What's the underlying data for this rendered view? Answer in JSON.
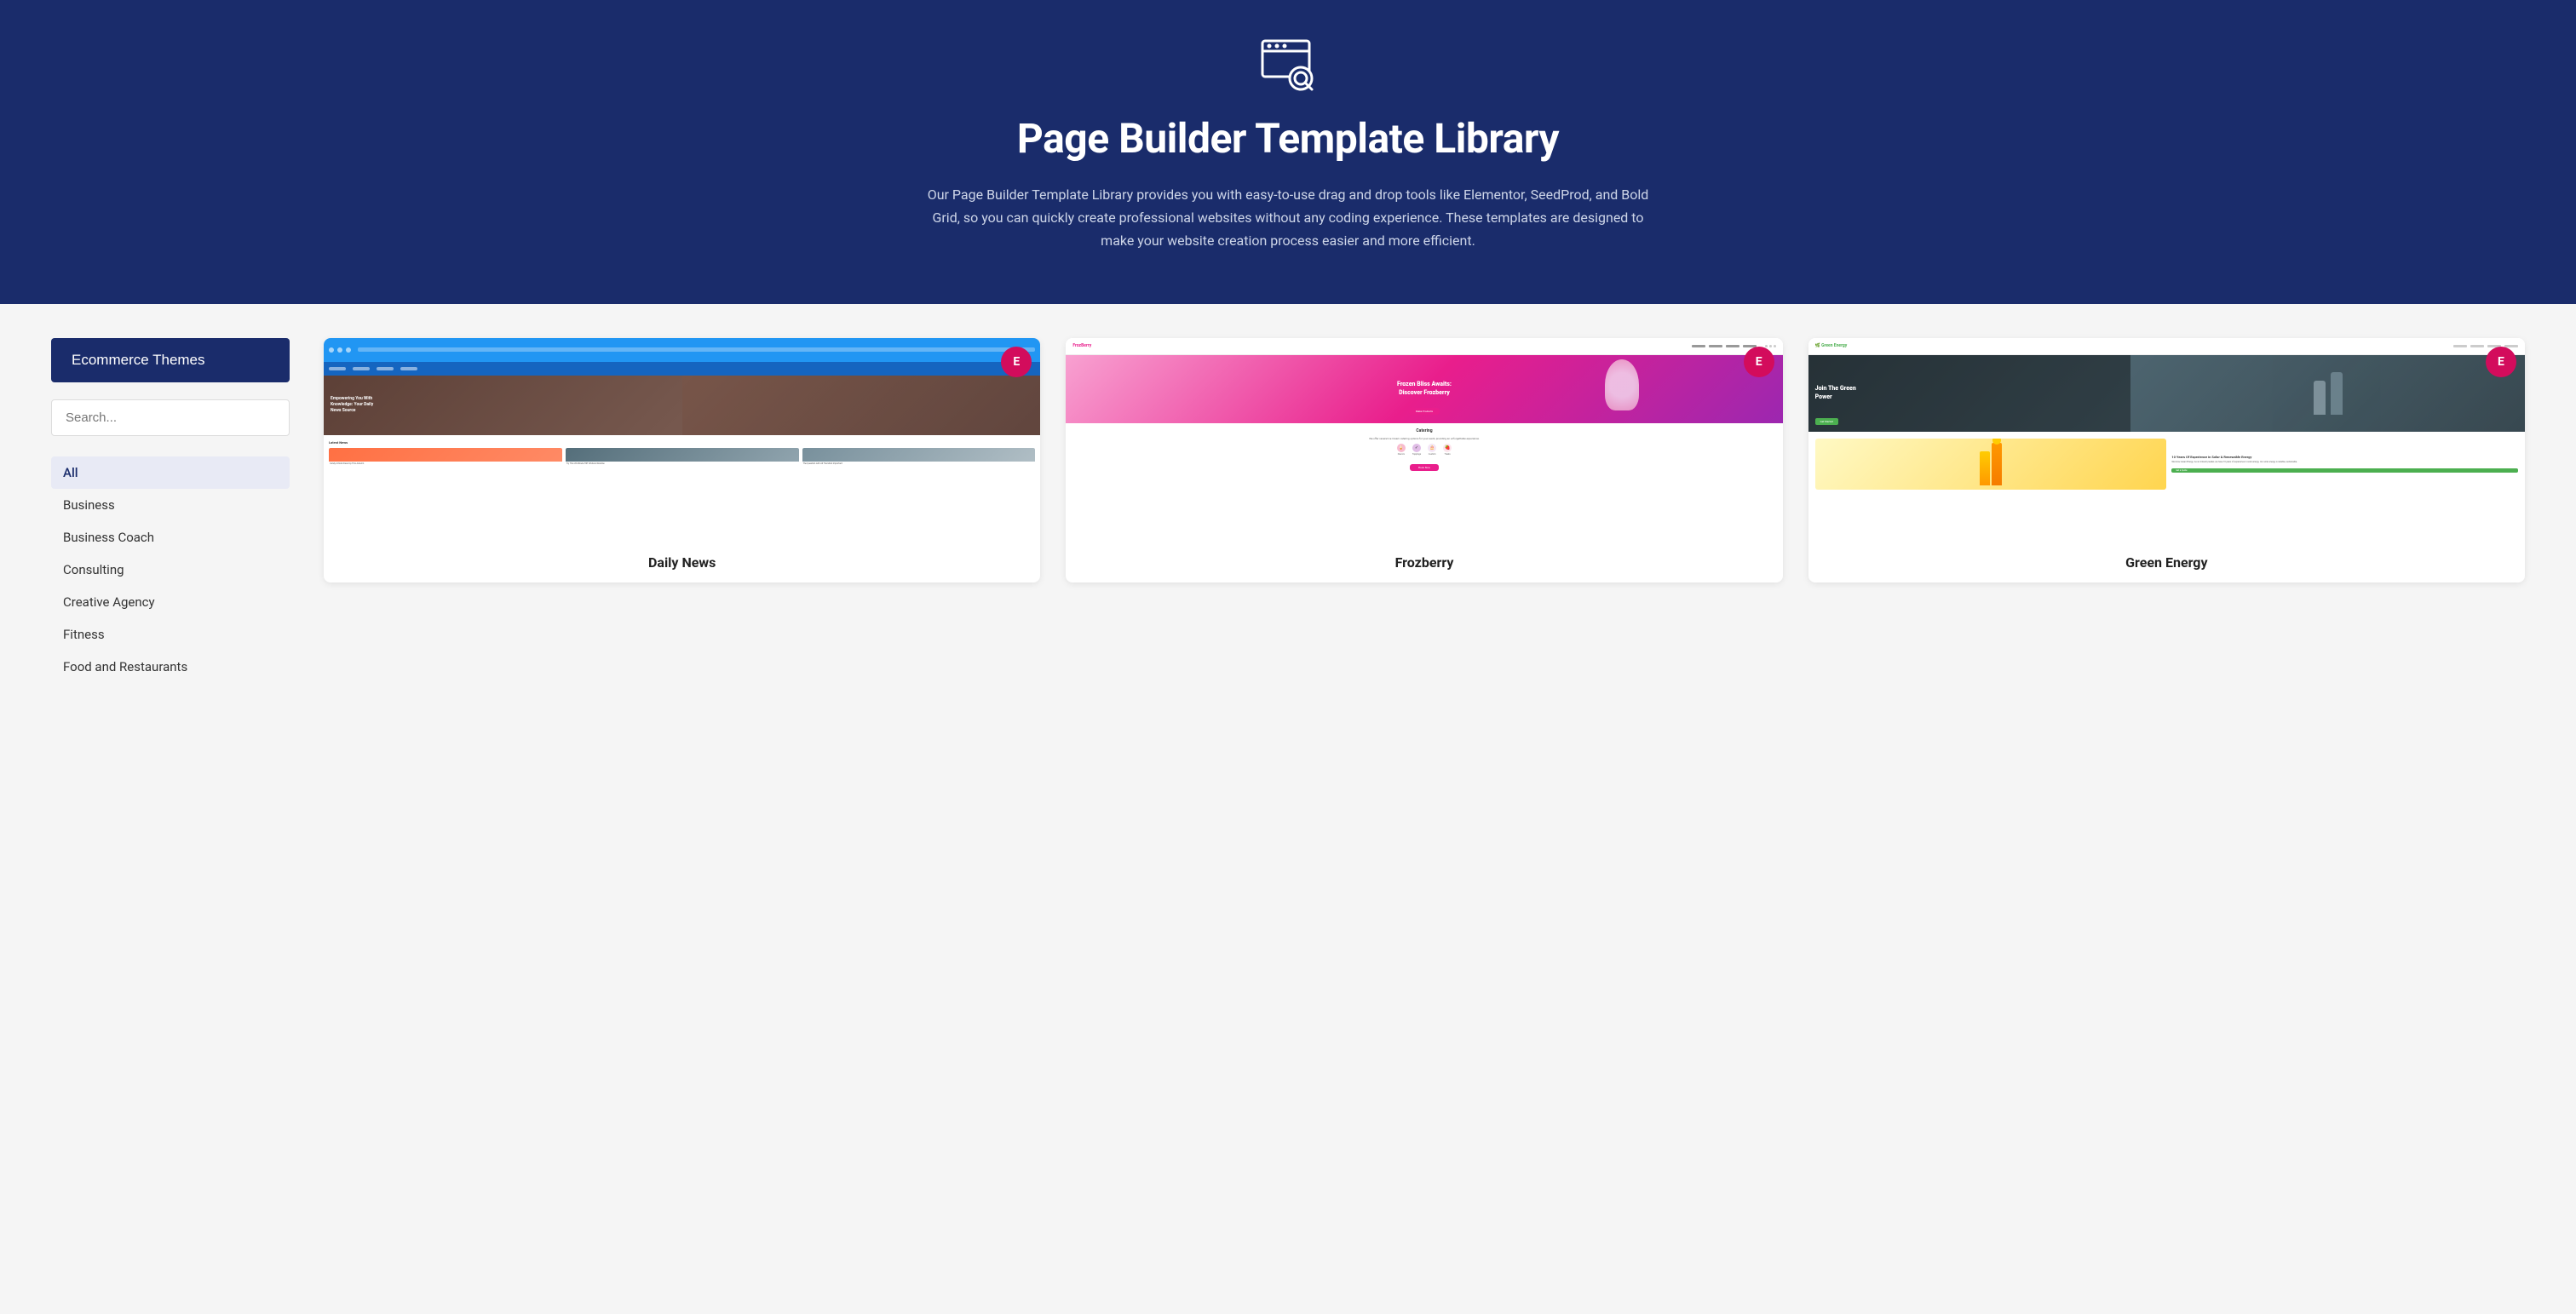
{
  "hero": {
    "title": "Page Builder Template Library",
    "description": "Our Page Builder Template Library provides you with easy-to-use drag and drop tools like Elementor, SeedProd, and Bold Grid, so you can quickly create professional websites without any coding experience. These templates are designed to make your website creation process easier and more efficient.",
    "icon_label": "search-preview-icon"
  },
  "sidebar": {
    "ecommerce_button": "Ecommerce Themes",
    "search_placeholder": "Search...",
    "filters": [
      {
        "label": "All",
        "active": true
      },
      {
        "label": "Business",
        "active": false
      },
      {
        "label": "Business Coach",
        "active": false
      },
      {
        "label": "Consulting",
        "active": false
      },
      {
        "label": "Creative Agency",
        "active": false
      },
      {
        "label": "Fitness",
        "active": false
      },
      {
        "label": "Food and Restaurants",
        "active": false
      }
    ]
  },
  "templates": [
    {
      "title": "Daily News",
      "badge": "E",
      "badge_color": "#d30c5c",
      "type": "daily-news"
    },
    {
      "title": "Frozberry",
      "badge": "E",
      "badge_color": "#d30c5c",
      "type": "frozberry"
    },
    {
      "title": "Green Energy",
      "badge": "E",
      "badge_color": "#d30c5c",
      "type": "green-energy"
    }
  ],
  "colors": {
    "hero_bg": "#1a2c6b",
    "sidebar_btn_bg": "#1a2c6b",
    "filter_active_bg": "#e8eaf5"
  }
}
